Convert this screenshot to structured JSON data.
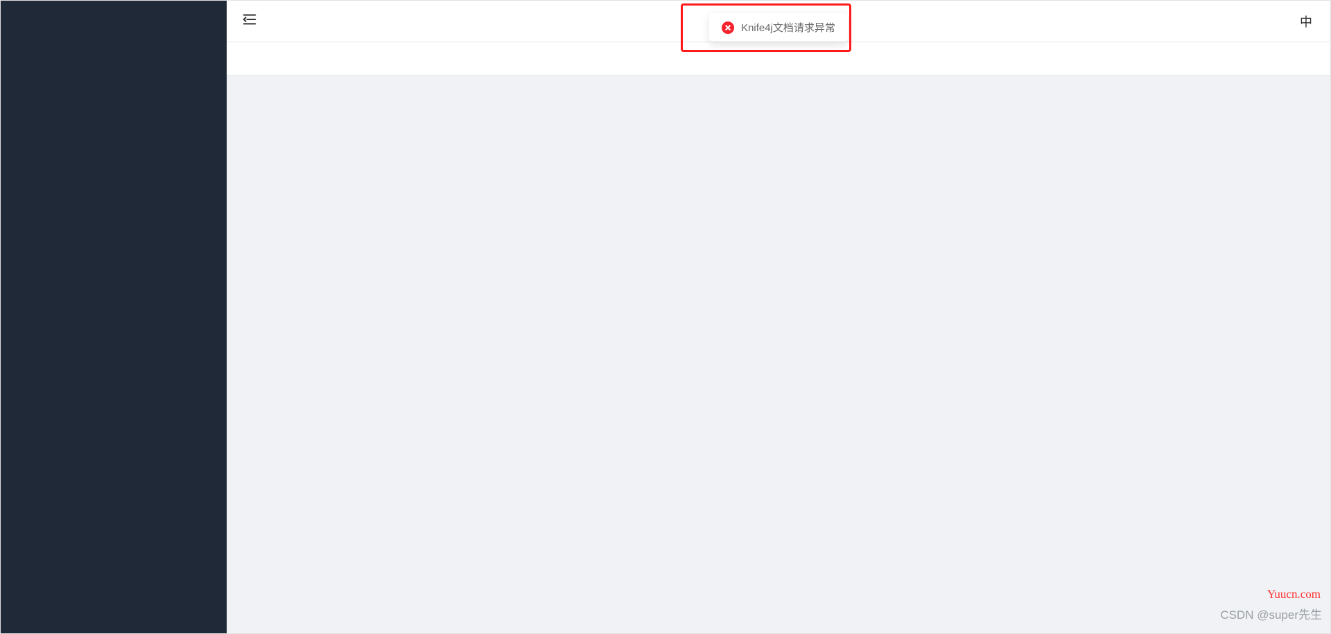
{
  "toast": {
    "message": "Knife4j文档请求异常"
  },
  "header": {
    "lang_label": "中"
  },
  "watermarks": {
    "site": "Yuucn.com",
    "author": "CSDN @super先生"
  }
}
